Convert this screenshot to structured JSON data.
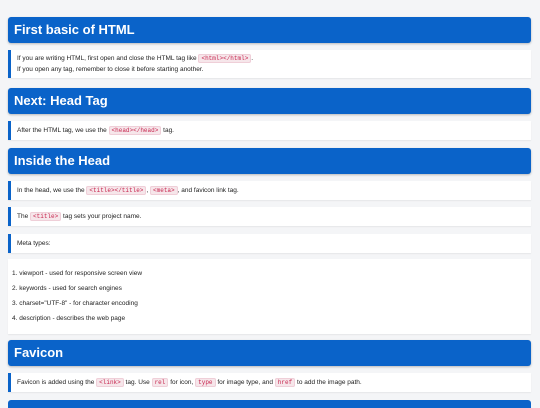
{
  "sections": [
    {
      "heading": "First basic of HTML",
      "note1": {
        "before": "If you are writing HTML, first open and close the HTML tag like ",
        "code": "<html></html>",
        "after": "."
      },
      "note2": "If you open any tag, remember to close it before starting another."
    },
    {
      "heading": "Next: Head Tag",
      "note": {
        "before": "After the HTML tag, we use the ",
        "code": "<head></head>",
        "after": " tag."
      }
    },
    {
      "heading": "Inside the Head",
      "note1": {
        "before": "In the head, we use the ",
        "code1": "<title></title>",
        "mid": ", ",
        "code2": "<meta>",
        "after": ", and favicon link tag."
      },
      "note2": {
        "before": "The ",
        "code": "<title>",
        "after": " tag sets your project name."
      },
      "note3": "Meta types:",
      "list": [
        "1. viewport - used for responsive screen view",
        "2. keywords - used for search engines",
        "3. charset=\"UTF-8\" - for character encoding",
        "4. description - describes the web page"
      ]
    },
    {
      "heading": "Favicon",
      "note": {
        "before": "Favicon is added using the ",
        "code1": "<link>",
        "t1": " tag. Use ",
        "code2": "rel",
        "t2": " for icon, ",
        "code3": "type",
        "t3": " for image type, and ",
        "code4": "href",
        "t4": " to add the image path."
      }
    }
  ]
}
